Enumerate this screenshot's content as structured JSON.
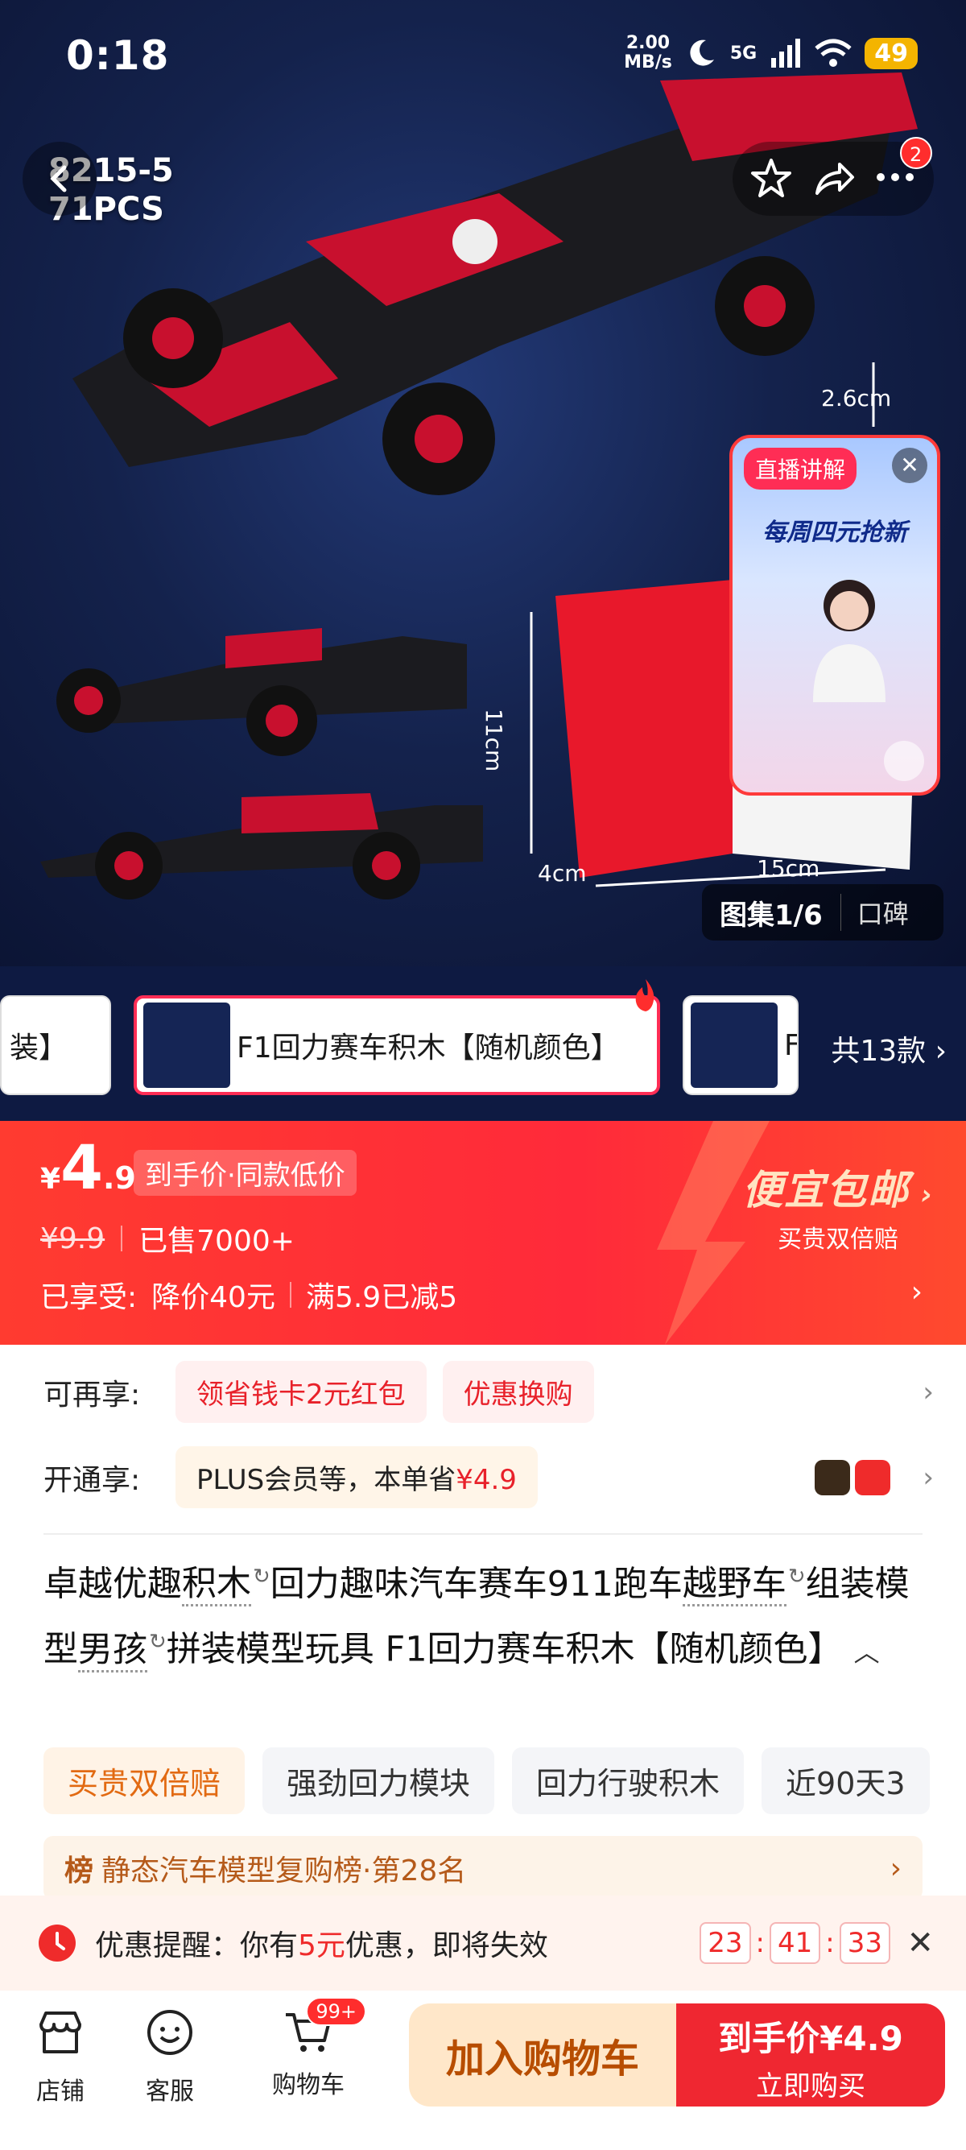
{
  "status_bar": {
    "time": "0:18",
    "net_speed_top": "2.00",
    "net_speed_bottom": "MB/s",
    "signal": "5G",
    "battery": "49"
  },
  "header": {
    "cart_badge": "2"
  },
  "hero": {
    "sku_line1": "8215-5",
    "sku_line2": "71PCS",
    "dim_height_small": "2.6cm",
    "dim_height": "11cm",
    "dim_depth": "4cm",
    "dim_width": "15cm",
    "gallery_counter": "图集1/6",
    "gallery_review": "口碑"
  },
  "live": {
    "tag": "直播讲解",
    "headline": "每周四元抢新"
  },
  "variants": {
    "prev_label": "装】",
    "active_label": "F1回力赛车积木【随机颜色】",
    "next_label": "F",
    "total": "共13款"
  },
  "price": {
    "currency": "¥",
    "int": "4",
    "dec": ".9",
    "tag": "到手价·同款低价",
    "original": "¥9.9",
    "sold": "已售7000+",
    "enjoyed_prefix": "已享受:",
    "discount1": "降价40元",
    "discount2": "满5.9已减5",
    "slogan": "便宜包邮",
    "slogan_sub": "买贵双倍赔"
  },
  "benefits": {
    "more_label": "可再享:",
    "chip1": "领省钱卡2元红包",
    "chip2": "优惠换购",
    "open_label": "开通享:",
    "plus_text": "PLUS会员等，本单省",
    "plus_amount": "¥4.9"
  },
  "title": {
    "part1": "卓越优趣",
    "kw1": "积木",
    "part2": "回力趣味汽车赛车911跑车",
    "kw2": "越野车",
    "part3": "组装模型",
    "kw3": "男孩",
    "part4": "拼装模型玩具 F1回力赛车积木【随机颜色】"
  },
  "tags": [
    "买贵双倍赔",
    "强劲回力模块",
    "回力行驶积木",
    "近90天3"
  ],
  "rank": {
    "icon": "榜",
    "text": "静态汽车模型复购榜·第28名"
  },
  "reminder": {
    "prefix": "优惠提醒：你有",
    "amount": "5元",
    "suffix": "优惠，即将失效",
    "hh": "23",
    "mm": "41",
    "ss": "33"
  },
  "bottom": {
    "store": "店铺",
    "service": "客服",
    "cart": "购物车",
    "cart_badge": "99+",
    "add_cart": "加入购物车",
    "buy_line1": "到手价¥4.9",
    "buy_line2": "立即购买"
  }
}
